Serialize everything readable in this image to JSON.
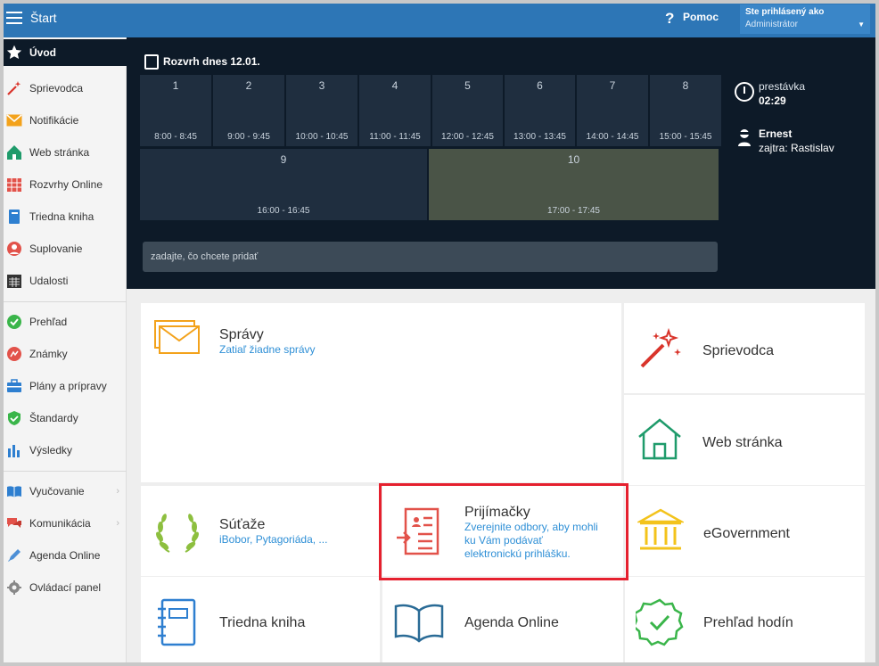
{
  "topbar": {
    "title": "Štart",
    "help": "Pomoc",
    "user_label": "Ste prihlásený ako",
    "user_name": "Administrátor"
  },
  "sidebar": {
    "items": [
      {
        "label": "Úvod",
        "icon": "star-icon"
      },
      {
        "label": "Sprievodca",
        "icon": "magic-wand-icon"
      },
      {
        "label": "Notifikácie",
        "icon": "envelope-icon"
      },
      {
        "label": "Web stránka",
        "icon": "house-icon"
      },
      {
        "label": "Rozvrhy Online",
        "icon": "calendar-grid-icon"
      },
      {
        "label": "Triedna kniha",
        "icon": "book-icon"
      },
      {
        "label": "Suplovanie",
        "icon": "person-icon"
      },
      {
        "label": "Udalosti",
        "icon": "calendar-icon"
      },
      {
        "label": "Prehľad",
        "icon": "check-circle-icon"
      },
      {
        "label": "Známky",
        "icon": "grade-icon"
      },
      {
        "label": "Plány a prípravy",
        "icon": "briefcase-icon"
      },
      {
        "label": "Štandardy",
        "icon": "shield-icon"
      },
      {
        "label": "Výsledky",
        "icon": "bar-chart-icon"
      },
      {
        "label": "Vyučovanie",
        "icon": "open-book-icon"
      },
      {
        "label": "Komunikácia",
        "icon": "chat-icon"
      },
      {
        "label": "Agenda Online",
        "icon": "pencil-icon"
      },
      {
        "label": "Ovládací panel",
        "icon": "gear-icon"
      }
    ]
  },
  "schedule": {
    "title": "Rozvrh dnes 12.01.",
    "slots": [
      {
        "num": "1",
        "time": "8:00 - 8:45"
      },
      {
        "num": "2",
        "time": "9:00 - 9:45"
      },
      {
        "num": "3",
        "time": "10:00 - 10:45"
      },
      {
        "num": "4",
        "time": "11:00 - 11:45"
      },
      {
        "num": "5",
        "time": "12:00 - 12:45"
      },
      {
        "num": "6",
        "time": "13:00 - 13:45"
      },
      {
        "num": "7",
        "time": "14:00 - 14:45"
      },
      {
        "num": "8",
        "time": "15:00 - 15:45"
      },
      {
        "num": "9",
        "time": "16:00 - 16:45"
      },
      {
        "num": "10",
        "time": "17:00 - 17:45"
      }
    ],
    "add_placeholder": "zadajte, čo chcete pridať",
    "break_label": "prestávka",
    "break_time": "02:29",
    "person_name": "Ernest",
    "person_tomorrow": "zajtra: Rastislav"
  },
  "tiles": {
    "spravy": {
      "title": "Správy",
      "subtitle": "Zatiaľ žiadne správy"
    },
    "sprievodca": {
      "title": "Sprievodca"
    },
    "web": {
      "title": "Web stránka"
    },
    "sutaze": {
      "title": "Súťaže",
      "subtitle": "iBobor, Pytagoriáda, ..."
    },
    "prijimacky": {
      "title": "Prijímačky",
      "subtitle_lines": [
        "Zverejnite odbory, aby mohli",
        "ku Vám podávať",
        "elektronickú prihlášku."
      ]
    },
    "egov": {
      "title": "eGovernment"
    },
    "trieda": {
      "title": "Triedna kniha"
    },
    "agenda": {
      "title": "Agenda Online"
    },
    "prehlad": {
      "title": "Prehľad hodín"
    }
  },
  "colors": {
    "topbar": "#2d76b6",
    "dark": "#0d1a28",
    "accent": "#2e8fd6",
    "highlight": "#e5202e"
  }
}
